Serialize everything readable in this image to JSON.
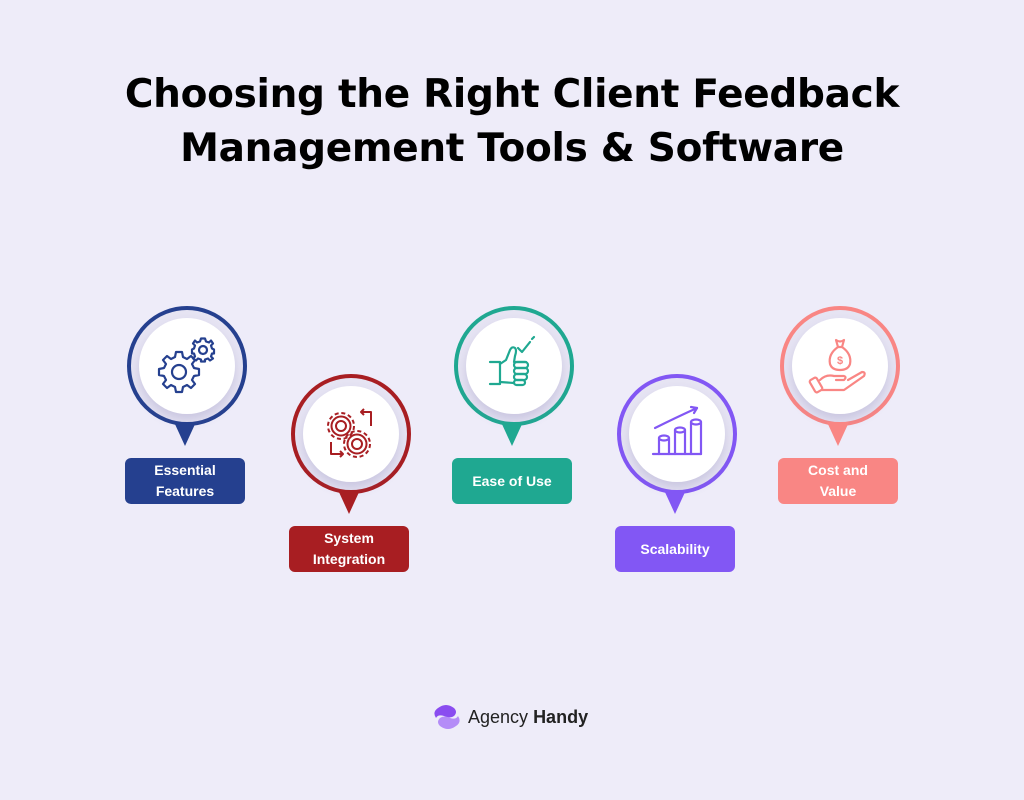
{
  "title": {
    "line1": "Choosing the Right Client Feedback",
    "line2": "Management Tools & Software"
  },
  "items": [
    {
      "label_line1": "Essential",
      "label_line2": "Features",
      "icon": "gears-icon",
      "color": "#25408f"
    },
    {
      "label_line1": "System",
      "label_line2": "Integration",
      "icon": "gears-sync-icon",
      "color": "#a81e22"
    },
    {
      "label_line1": "Ease of Use",
      "label_line2": "",
      "icon": "thumbs-up-check-icon",
      "color": "#1fa891"
    },
    {
      "label_line1": "Scalability",
      "label_line2": "",
      "icon": "growth-chart-icon",
      "color": "#8257f4"
    },
    {
      "label_line1": "Cost and",
      "label_line2": "Value",
      "icon": "money-hand-icon",
      "color": "#f98684"
    }
  ],
  "brand": {
    "name_regular": "Agency",
    "name_bold": "Handy",
    "logo_colors": [
      "#8a4cf0",
      "#b48cf7"
    ]
  }
}
